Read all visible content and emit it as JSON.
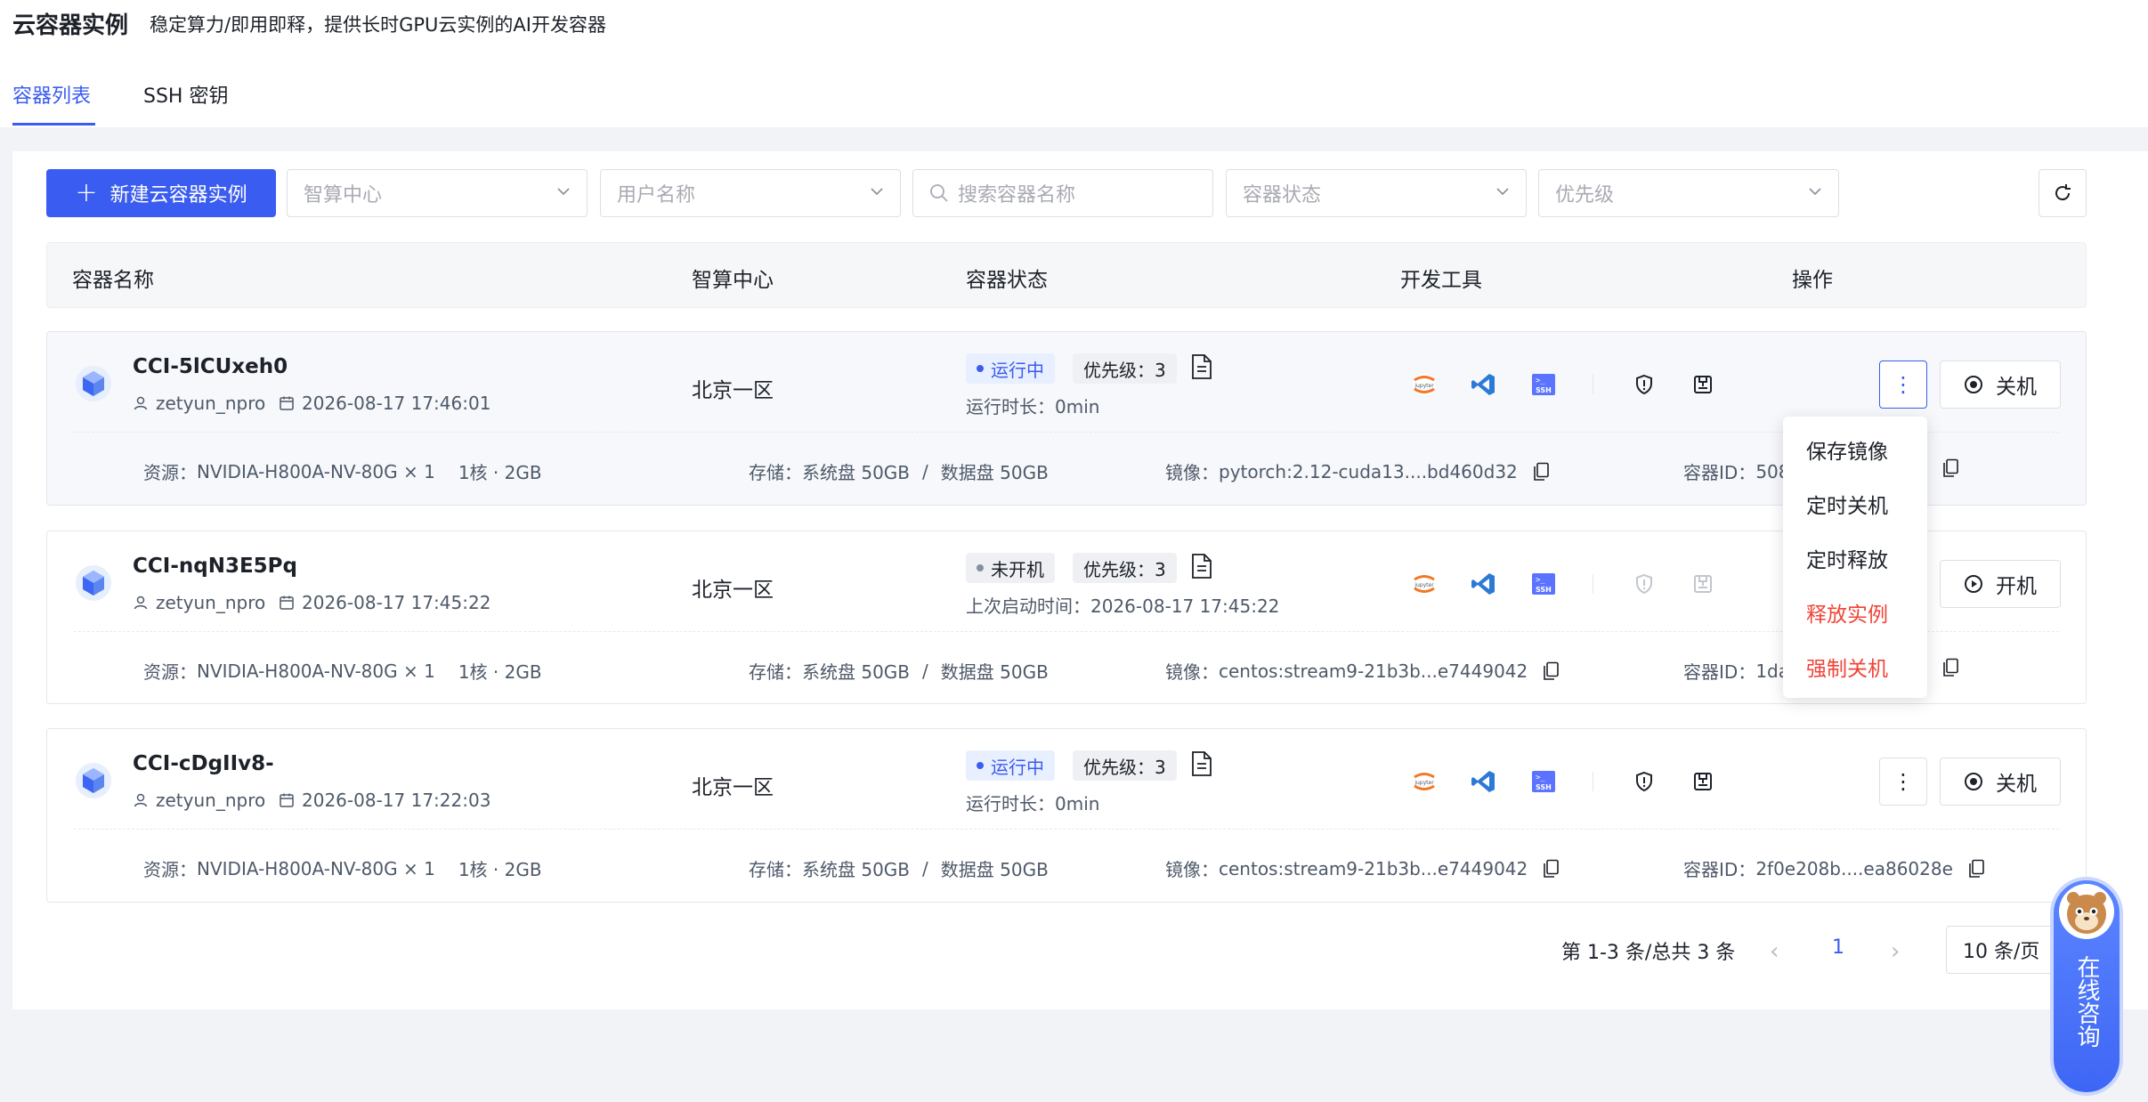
{
  "header": {
    "title": "云容器实例",
    "subtitle": "稳定算力/即用即释，提供长时GPU云实例的AI开发容器"
  },
  "tabs": [
    {
      "label": "容器列表",
      "active": true
    },
    {
      "label": "SSH 密钥",
      "active": false
    }
  ],
  "toolbar": {
    "create_label": "新建云容器实例",
    "filters": {
      "center_placeholder": "智算中心",
      "user_placeholder": "用户名称",
      "search_placeholder": "搜索容器名称",
      "status_placeholder": "容器状态",
      "priority_placeholder": "优先级"
    }
  },
  "table": {
    "columns": [
      "容器名称",
      "智算中心",
      "容器状态",
      "开发工具",
      "操作"
    ]
  },
  "labels": {
    "resource": "资源：",
    "storage": "存储：",
    "image": "镜像：",
    "container_id": "容器ID：",
    "storage_sep": "/"
  },
  "containers": [
    {
      "name": "CCI-5lCUxeh0",
      "user": "zetyun_npro",
      "created": "2026-08-17 17:46:01",
      "center": "北京一区",
      "status": "运行中",
      "priority": "优先级：3",
      "meta": "运行时长：0min",
      "resource": "NVIDIA-H800A-NV-80G × 1",
      "cpu_mem": "1核 · 2GB",
      "sys_disk": "系统盘 50GB",
      "data_disk": "数据盘 50GB",
      "image": "pytorch:2.12-cuda13....bd460d32",
      "container_id": "508",
      "action": "关机"
    },
    {
      "name": "CCI-nqN3E5Pq",
      "user": "zetyun_npro",
      "created": "2026-08-17 17:45:22",
      "center": "北京一区",
      "status": "未开机",
      "priority": "优先级：3",
      "meta": "上次启动时间：2026-08-17 17:45:22",
      "resource": "NVIDIA-H800A-NV-80G × 1",
      "cpu_mem": "1核 · 2GB",
      "sys_disk": "系统盘 50GB",
      "data_disk": "数据盘 50GB",
      "image": "centos:stream9-21b3b...e7449042",
      "container_id": "1da",
      "action": "开机"
    },
    {
      "name": "CCI-cDgIIv8-",
      "user": "zetyun_npro",
      "created": "2026-08-17 17:22:03",
      "center": "北京一区",
      "status": "运行中",
      "priority": "优先级：3",
      "meta": "运行时长：0min",
      "resource": "NVIDIA-H800A-NV-80G × 1",
      "cpu_mem": "1核 · 2GB",
      "sys_disk": "系统盘 50GB",
      "data_disk": "数据盘 50GB",
      "image": "centos:stream9-21b3b...e7449042",
      "container_id": "2f0e208b....ea86028e",
      "action": "关机"
    }
  ],
  "dropdown_menu": [
    {
      "label": "保存镜像",
      "danger": false
    },
    {
      "label": "定时关机",
      "danger": false
    },
    {
      "label": "定时释放",
      "danger": false
    },
    {
      "label": "释放实例",
      "danger": true
    },
    {
      "label": "强制关机",
      "danger": true
    }
  ],
  "pagination": {
    "summary": "第 1-3 条/总共 3 条",
    "current_page": "1",
    "page_size": "10 条/页",
    "prev_icon": "chevron-left-icon",
    "next_icon": "chevron-right-icon"
  },
  "consult": {
    "label": "在线咨询"
  },
  "colors": {
    "accent": "#3b5cf0",
    "danger": "#f04438",
    "running_bg": "#e8f0ff",
    "off_dot": "#86909c"
  }
}
